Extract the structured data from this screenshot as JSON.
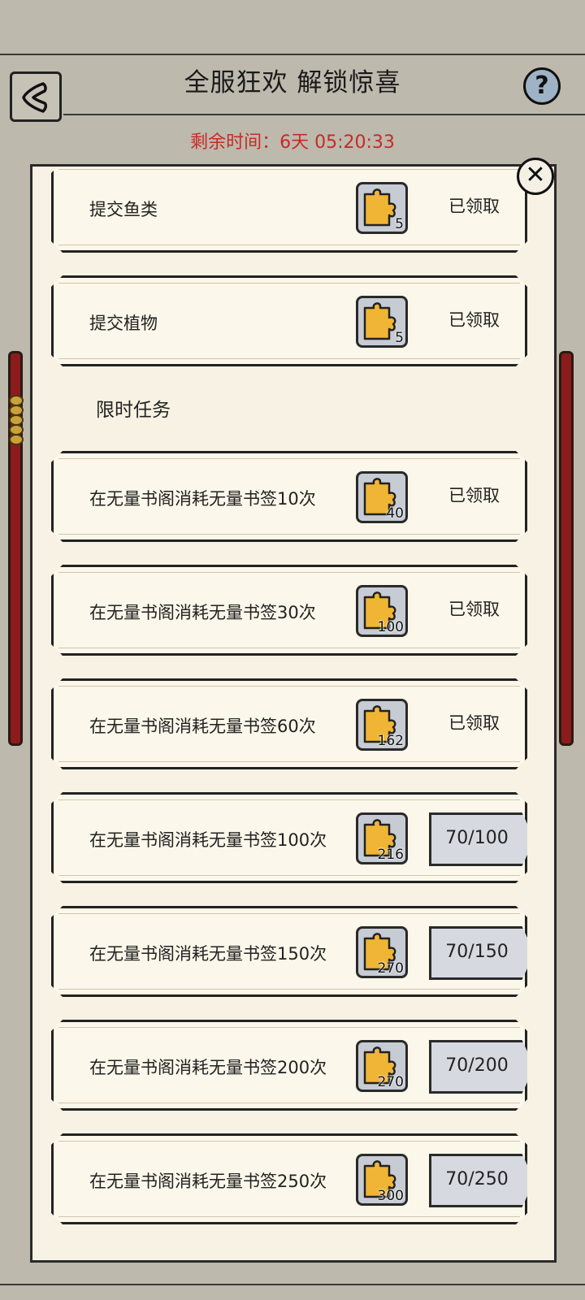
{
  "header": {
    "title": "全服狂欢 解锁惊喜",
    "timer_label": "剩余时间：6天 05:20:33",
    "help_label": "?"
  },
  "panel": {
    "close_label": "✕",
    "section_title": "限时任务",
    "tasks": [
      {
        "label": "提交鱼类",
        "reward": "5",
        "status": "已领取"
      },
      {
        "label": "提交植物",
        "reward": "5",
        "status": "已领取"
      },
      {
        "label": "在无量书阁消耗无量书签10次",
        "reward": "40",
        "status": "已领取"
      },
      {
        "label": "在无量书阁消耗无量书签30次",
        "reward": "100",
        "status": "已领取"
      },
      {
        "label": "在无量书阁消耗无量书签60次",
        "reward": "162",
        "status": "已领取"
      },
      {
        "label": "在无量书阁消耗无量书签100次",
        "reward": "216",
        "progress": "70/100"
      },
      {
        "label": "在无量书阁消耗无量书签150次",
        "reward": "270",
        "progress": "70/150"
      },
      {
        "label": "在无量书阁消耗无量书签200次",
        "reward": "270",
        "progress": "70/200"
      },
      {
        "label": "在无量书阁消耗无量书签250次",
        "reward": "300",
        "progress": "70/250"
      }
    ]
  },
  "colors": {
    "background": "#bdb9ad",
    "panel": "#f7f2e3",
    "timer_red": "#c72a26",
    "puzzle_gold": "#f0b534",
    "scroll_red": "#8c1c1c"
  },
  "icons": {
    "back": "back-arrow-icon",
    "help": "question-mark-icon",
    "close": "close-icon",
    "reward": "puzzle-piece-icon"
  }
}
